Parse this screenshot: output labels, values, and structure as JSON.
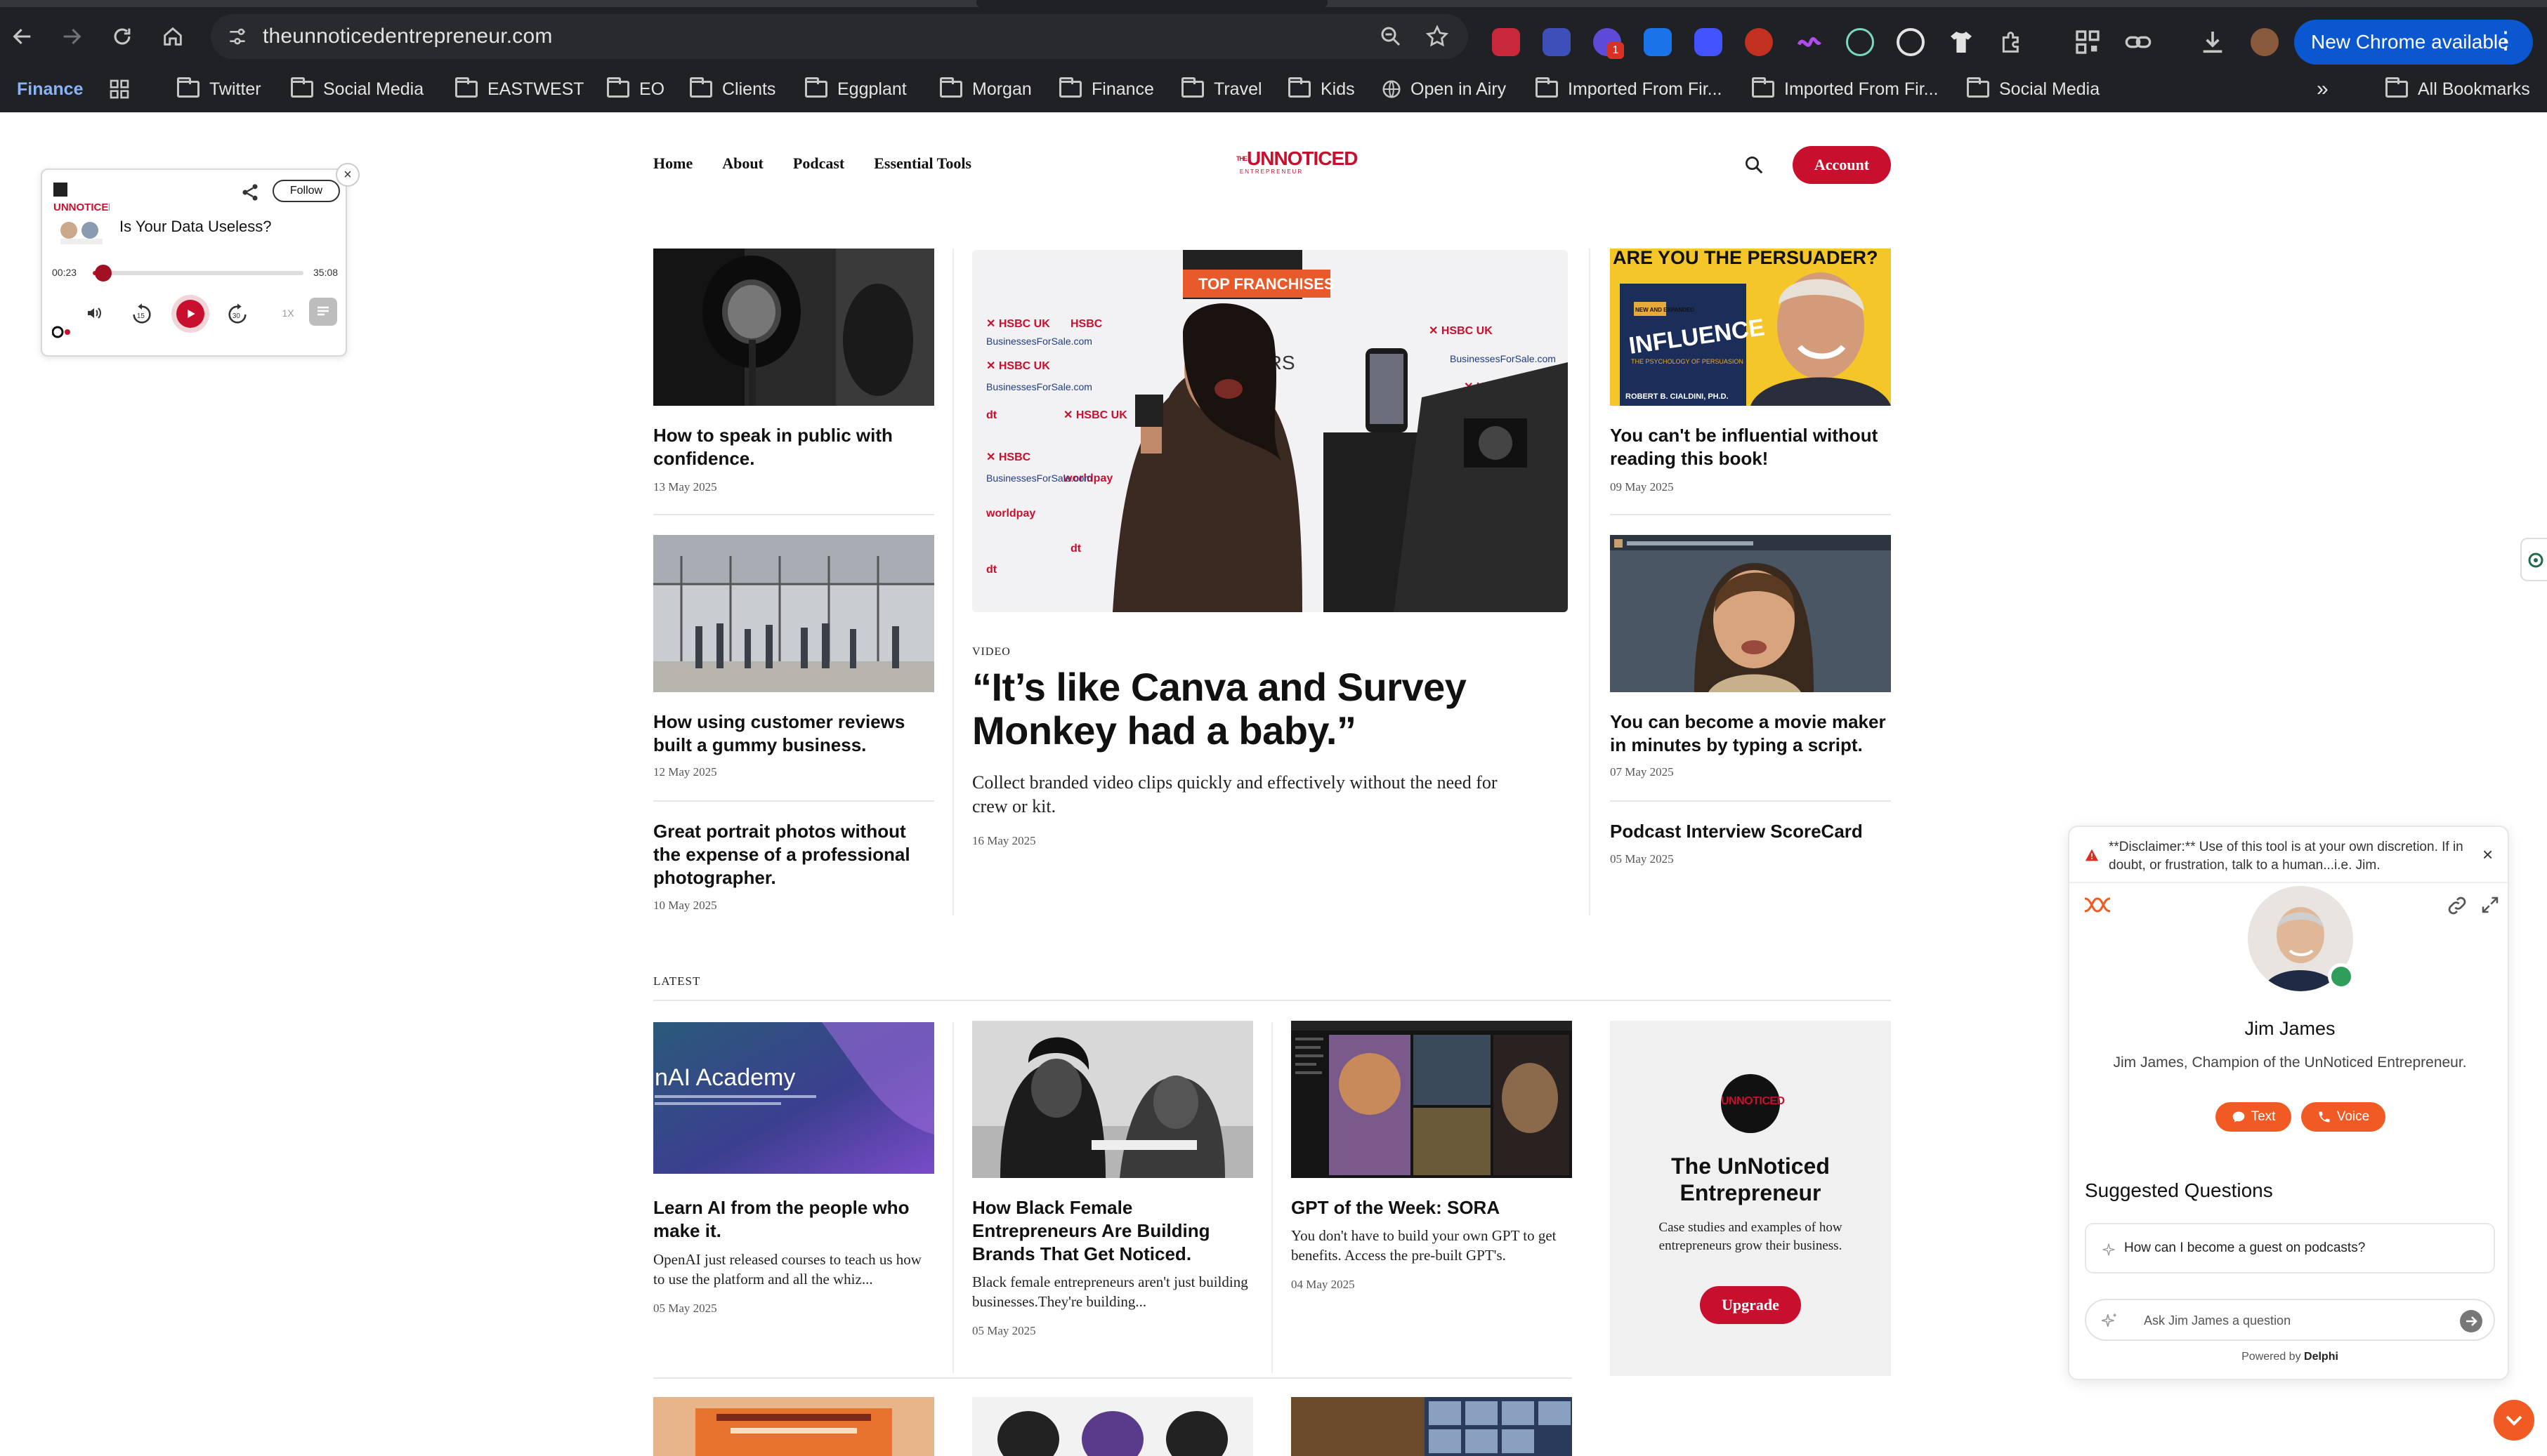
{
  "browser": {
    "url": "theunnoticedentrepreneur.com",
    "update_label": "New Chrome available",
    "badge_count": "1",
    "bookmarks": [
      {
        "label": "Finance",
        "folder": false
      },
      {
        "label": "Twitter",
        "folder": true
      },
      {
        "label": "Social Media",
        "folder": true
      },
      {
        "label": "EASTWEST",
        "folder": true
      },
      {
        "label": "EO",
        "folder": true
      },
      {
        "label": "Clients",
        "folder": true
      },
      {
        "label": "Eggplant",
        "folder": true
      },
      {
        "label": "Morgan",
        "folder": true
      },
      {
        "label": "Finance",
        "folder": true
      },
      {
        "label": "Travel",
        "folder": true
      },
      {
        "label": "Kids",
        "folder": true
      },
      {
        "label": "Open in Airy",
        "folder": false
      },
      {
        "label": "Imported From Fir...",
        "folder": true
      },
      {
        "label": "Imported From Fir...",
        "folder": true
      },
      {
        "label": "Social Media",
        "folder": true
      }
    ],
    "all_bookmarks_label": "All Bookmarks",
    "more_label": "»"
  },
  "site": {
    "nav": [
      "Home",
      "About",
      "Podcast",
      "Essential Tools"
    ],
    "logo_line1": "UNNOTICED",
    "logo_line2": "ENTREPRENEUR",
    "logo_prefix": "THE",
    "account_label": "Account"
  },
  "left_articles": [
    {
      "title": "How to speak in public with confidence.",
      "date": "13 May 2025"
    },
    {
      "title": "How using customer reviews built a gummy business.",
      "date": "12 May 2025"
    },
    {
      "title": "Great portrait photos without the expense of a professional photographer.",
      "date": "10 May 2025"
    }
  ],
  "feature": {
    "kicker": "VIDEO",
    "title": "“It’s like Canva and Survey Monkey had a baby.”",
    "excerpt": "Collect branded video clips quickly and effectively without the need for crew or kit.",
    "date": "16 May 2025",
    "banner_text": "TOP FRANCHISES",
    "sponsor_text": "NSORS"
  },
  "right_articles": [
    {
      "title": "You can't be influential without reading this book!",
      "date": "09 May 2025"
    },
    {
      "title": "You can become a movie maker in minutes by typing a script.",
      "date": "07 May 2025"
    },
    {
      "title": "Podcast Interview ScoreCard",
      "date": "05 May 2025"
    }
  ],
  "book": {
    "headline": "ARE YOU THE PERSUADER?",
    "title": "INFLUENCE",
    "subtitle": "THE PSYCHOLOGY OF PERSUASION",
    "author": "ROBERT B. CIALDINI, PH.D.",
    "badge": "NEW AND EXPANDED"
  },
  "latest": {
    "label": "LATEST",
    "items": [
      {
        "title": "Learn AI from the people who make it.",
        "excerpt": "OpenAI just released courses to teach us how to use the platform and all the whiz...",
        "date": "05 May 2025",
        "thumb_text": "nAI Academy"
      },
      {
        "title": "How Black Female Entrepreneurs Are Building Brands That Get Noticed.",
        "excerpt": "Black female entrepreneurs aren't just building businesses.They're building...",
        "date": "05 May 2025"
      },
      {
        "title": "GPT of the Week: SORA",
        "excerpt": "You don't have to build your own GPT to get benefits. Access the pre-built GPT's.",
        "date": "04 May 2025"
      }
    ]
  },
  "promo": {
    "logo_text": "UNNOTICED",
    "title": "The UnNoticed Entrepreneur",
    "description": "Case studies and examples of how entrepreneurs grow their business.",
    "cta": "Upgrade"
  },
  "player": {
    "episode_title": "Is Your Data Useless?",
    "follow_label": "Follow",
    "elapsed": "00:23",
    "duration": "35:08",
    "progress": 0.011,
    "speed": "1X",
    "skip_back": "15",
    "skip_fwd": "30",
    "cover_text": "UNNOTICED"
  },
  "chat": {
    "disclaimer": "**Disclaimer:** Use of this tool is at your own discretion. If in doubt, or frustration, talk to a human...i.e. Jim.",
    "name": "Jim James",
    "tagline": "Jim James, Champion of the UnNoticed Entrepreneur.",
    "text_label": "Text",
    "voice_label": "Voice",
    "suggested_title": "Suggested Questions",
    "suggested": [
      "How can I become a guest on podcasts?"
    ],
    "ask_placeholder": "Ask Jim James a question",
    "powered_by": "Powered by",
    "powered_brand": "Delphi"
  },
  "colors": {
    "brand_red": "#c8102e",
    "chat_accent": "#f15a22",
    "chrome_bg": "#202124"
  }
}
